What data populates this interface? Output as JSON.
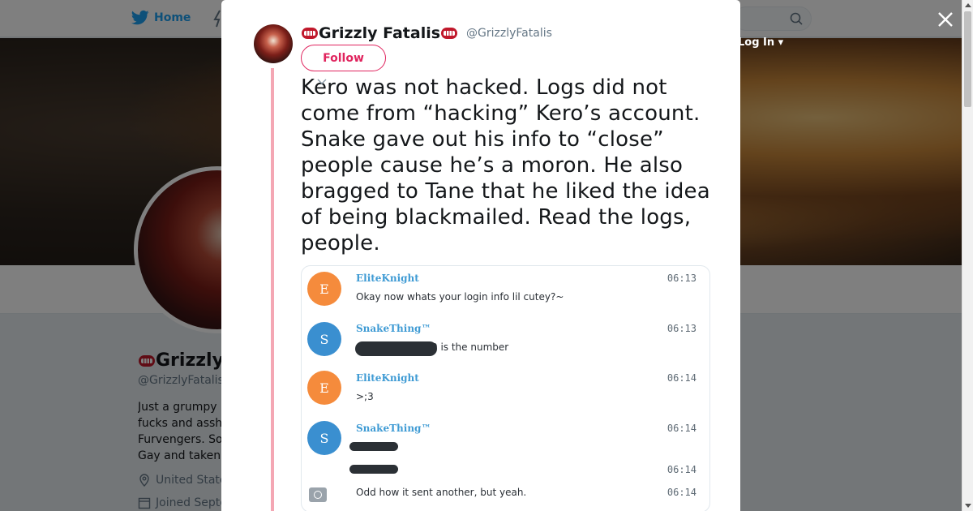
{
  "topnav": {
    "home_label": "Home",
    "login_label": "Log In"
  },
  "profile": {
    "name": "Grizzly",
    "handle": "@GrizzlyFatalis",
    "bio_lines": [
      "Just a grumpy ",
      "fucks and assh",
      "Furvengers. So",
      "Gay and taken"
    ],
    "location": "United State",
    "joined": "Joined Septe"
  },
  "tweet": {
    "author_name": "Grizzly Fatalis",
    "author_handle": "@GrizzlyFatalis",
    "follow_label": "Follow",
    "text": "Kero was not hacked. Logs did not come from “hacking” Kero’s account. Snake gave out his info to “close” people cause he’s a moron. He also bragged to Tane that he liked the idea of being blackmailed. Read the logs, people."
  },
  "chat_log": {
    "messages": [
      {
        "initial": "E",
        "user": "EliteKnight",
        "time": "06:13",
        "text": "Okay now whats your login info lil cutey?~"
      },
      {
        "initial": "S",
        "user": "SnakeThing™",
        "time": "06:13",
        "text": "0 is the number"
      },
      {
        "initial": "E",
        "user": "EliteKnight",
        "time": "06:14",
        "text": ">;3"
      },
      {
        "initial": "S",
        "user": "SnakeThing™",
        "time": "06:14",
        "text": ""
      },
      {
        "time": "06:14",
        "text": ""
      },
      {
        "time": "06:14",
        "text": "Odd how it sent another, but yeah."
      }
    ]
  },
  "colors": {
    "accent": "#1da1f2",
    "follow": "#e0245e",
    "thread_line": "#f4a7b4"
  }
}
